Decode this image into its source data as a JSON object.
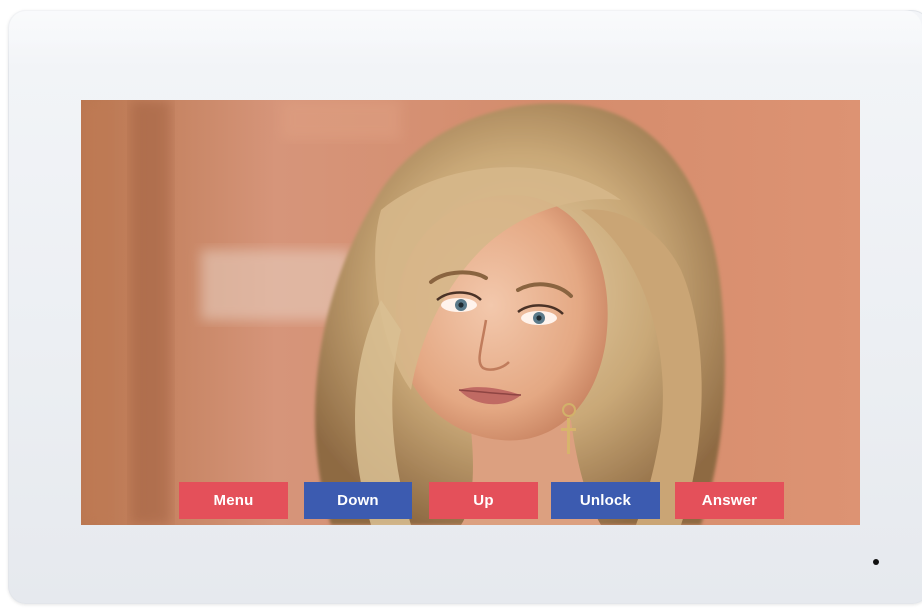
{
  "buttons": {
    "menu": "Menu",
    "down": "Down",
    "up": "Up",
    "unlock": "Unlock",
    "answer": "Answer"
  },
  "colors": {
    "button_red": "#e4505a",
    "button_blue": "#3c5bb0",
    "bezel": "#eceff3"
  },
  "icons": {
    "indicator": "status-led-icon"
  }
}
